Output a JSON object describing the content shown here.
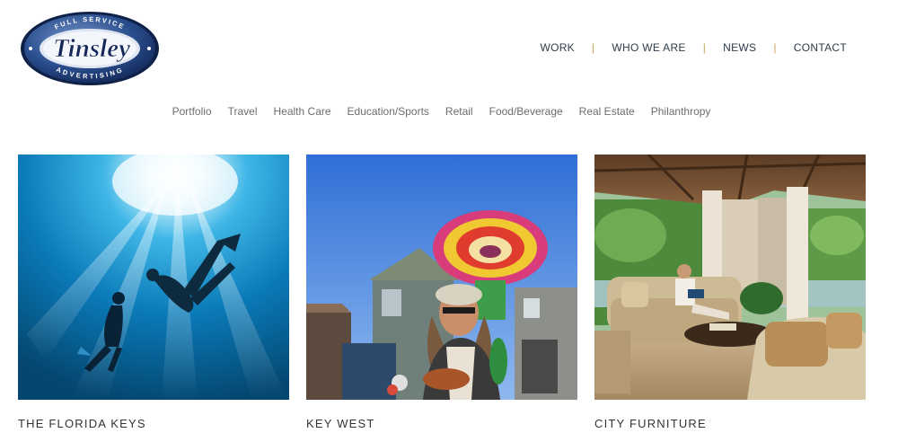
{
  "brand": {
    "logo_word": "Tinsley",
    "logo_top_arc": "FULL SERVICE",
    "logo_bottom_arc": "ADVERTISING"
  },
  "nav": {
    "items": [
      "WORK",
      "WHO WE ARE",
      "NEWS",
      "CONTACT"
    ],
    "separator": "|"
  },
  "categories": [
    "Portfolio",
    "Travel",
    "Health Care",
    "Education/Sports",
    "Retail",
    "Food/Beverage",
    "Real Estate",
    "Philanthropy"
  ],
  "portfolio": [
    {
      "title": "THE FLORIDA KEYS",
      "image": "underwater-divers-photo"
    },
    {
      "title": "KEY WEST",
      "image": "key-west-street-performer-photo"
    },
    {
      "title": "CITY FURNITURE",
      "image": "patio-living-room-photo"
    }
  ],
  "colors": {
    "nav_text": "#2f3b4a",
    "separator": "#c9a25a",
    "category_text": "#6d6d6d",
    "logo_navy": "#1d3a6b"
  }
}
